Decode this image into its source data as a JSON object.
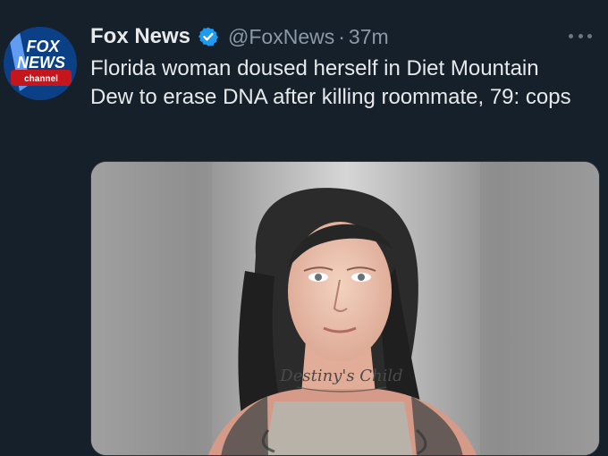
{
  "tweet": {
    "author_name": "Fox News",
    "author_handle": "@FoxNews",
    "separator": "·",
    "timestamp": "37m",
    "text": "Florida woman doused herself in Diet Mountain Dew to erase DNA after killing roommate, 79: cops",
    "verified": true,
    "avatar_logo": {
      "line1": "FOX",
      "line2": "NEWS",
      "line3": "channel"
    },
    "media_image_text": "Destiny's Child"
  },
  "icons": {
    "verified": "verified-badge-icon",
    "more": "more-options-icon"
  },
  "colors": {
    "background": "#15202b",
    "primary_text": "#e7e9ea",
    "secondary_text": "#8b98a5",
    "verified": "#1d9bf0",
    "fox_blue": "#0b3f86",
    "fox_red": "#c4161c"
  }
}
